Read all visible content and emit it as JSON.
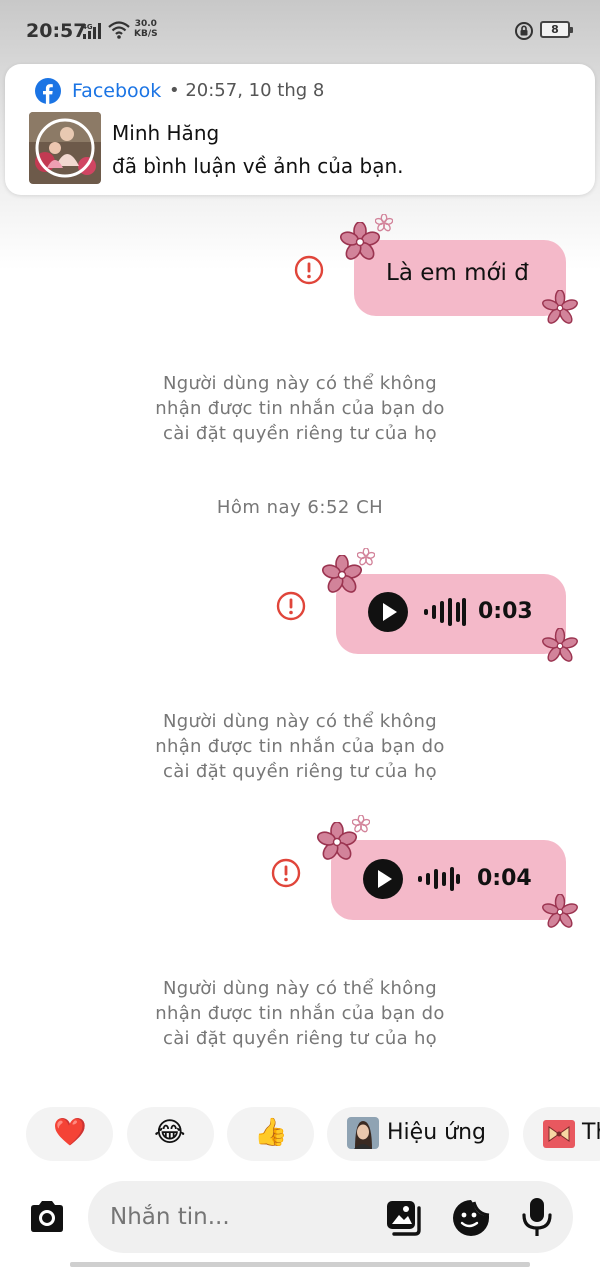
{
  "status_bar": {
    "time": "20:57",
    "network": "4G",
    "speed_value": "30.0",
    "speed_unit": "KB/S",
    "battery": "8"
  },
  "notification": {
    "app": "Facebook",
    "time": "• 20:57, 10 thg 8",
    "title": "Minh Hăng",
    "body": "đã bình luận về ảnh của bạn."
  },
  "messages": [
    {
      "type": "text",
      "text": "Là em mới đ"
    },
    {
      "type": "voice",
      "duration": "0:03"
    },
    {
      "type": "voice",
      "duration": "0:04"
    }
  ],
  "undelivered_notice": [
    "Người dùng này có thể không",
    "nhận được tin nhắn của bạn do",
    "cài đặt quyền riêng tư của họ"
  ],
  "timestamp": "Hôm nay 6:52 CH",
  "reactions": [
    {
      "icon": "heart-icon",
      "emoji": "❤️"
    },
    {
      "icon": "laugh-cry-icon",
      "emoji": "😂"
    },
    {
      "icon": "thumbs-up-icon",
      "emoji": "👍"
    },
    {
      "icon": "effects-avatar",
      "label": "Hiệu ứng"
    },
    {
      "icon": "gift-icon",
      "label": "Th"
    }
  ],
  "composer": {
    "placeholder": "Nhắn tin..."
  },
  "colors": {
    "bubble": "#f4b9c9",
    "error": "#e0453a",
    "facebook": "#1b74e4"
  }
}
